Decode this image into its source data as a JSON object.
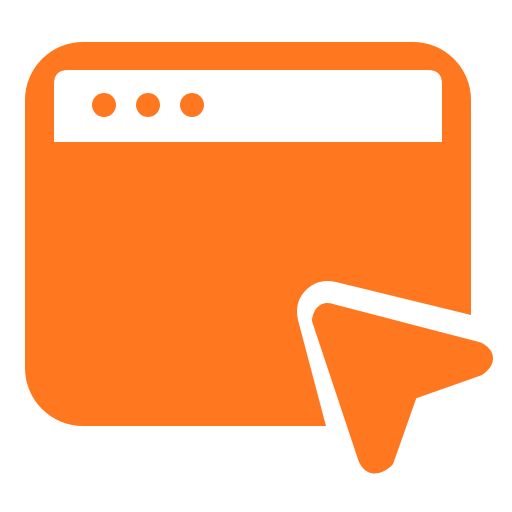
{
  "icon": {
    "name": "browser-window-cursor-icon",
    "color": "#FF771F",
    "background": "#FFFFFF"
  }
}
